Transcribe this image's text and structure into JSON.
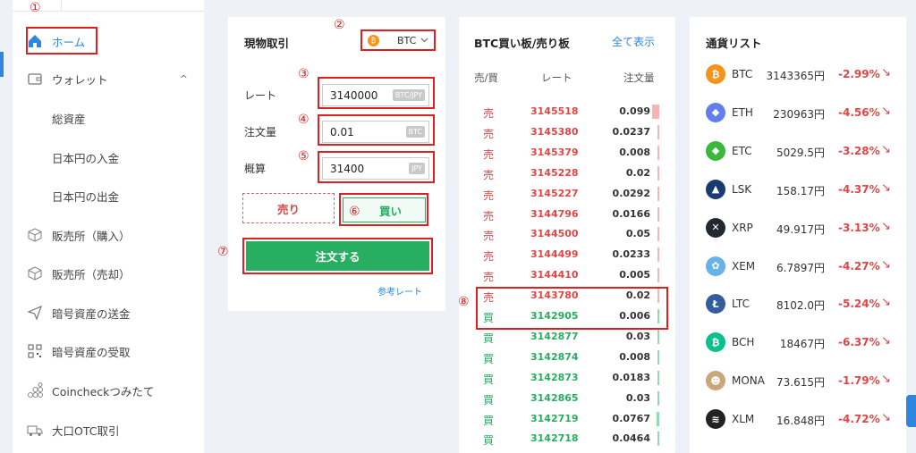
{
  "annotations": [
    "①",
    "②",
    "③",
    "④",
    "⑤",
    "⑥",
    "⑦",
    "⑧"
  ],
  "sidebar": {
    "items": [
      {
        "label": "ホーム",
        "icon": "home-icon"
      },
      {
        "label": "ウォレット",
        "icon": "wallet-icon",
        "caret": "^"
      },
      {
        "label": "総資産"
      },
      {
        "label": "日本円の入金"
      },
      {
        "label": "日本円の出金"
      },
      {
        "label": "販売所（購入）",
        "icon": "cube-icon"
      },
      {
        "label": "販売所（売却）",
        "icon": "cube-icon"
      },
      {
        "label": "暗号資産の送金",
        "icon": "send-icon"
      },
      {
        "label": "暗号資産の受取",
        "icon": "qr-icon"
      },
      {
        "label": "Coincheckつみたて",
        "icon": "coins-icon"
      },
      {
        "label": "大口OTC取引",
        "icon": "truck-icon"
      }
    ]
  },
  "trade": {
    "title": "現物取引",
    "coin": "BTC",
    "coin_glyph": "₿",
    "rate_label": "レート",
    "rate_value": "3140000",
    "rate_unit": "BTC/JPY",
    "amount_label": "注文量",
    "amount_value": "0.01",
    "amount_unit": "BTC",
    "estimate_label": "概算",
    "estimate_value": "31400",
    "estimate_unit": "JPY",
    "sell_label": "売り",
    "buy_label": "買い",
    "order_button": "注文する",
    "ref_link": "参考レート"
  },
  "orderbook": {
    "title": "BTC買い板/売り板",
    "show_all": "全て表示",
    "headers": [
      "売/買",
      "レート",
      "注文量"
    ],
    "rows": [
      {
        "side": "売",
        "rate": "3145518",
        "qty": "0.099",
        "fill": 0.9
      },
      {
        "side": "売",
        "rate": "3145380",
        "qty": "0.0237",
        "fill": 0.1
      },
      {
        "side": "売",
        "rate": "3145379",
        "qty": "0.008",
        "fill": 0.05
      },
      {
        "side": "売",
        "rate": "3145228",
        "qty": "0.02",
        "fill": 0.08
      },
      {
        "side": "売",
        "rate": "3145227",
        "qty": "0.0292",
        "fill": 0.12
      },
      {
        "side": "売",
        "rate": "3144796",
        "qty": "0.0166",
        "fill": 0.07
      },
      {
        "side": "売",
        "rate": "3144500",
        "qty": "0.05",
        "fill": 0.2
      },
      {
        "side": "売",
        "rate": "3144499",
        "qty": "0.0233",
        "fill": 0.1
      },
      {
        "side": "売",
        "rate": "3144410",
        "qty": "0.005",
        "fill": 0.03
      },
      {
        "side": "売",
        "rate": "3143780",
        "qty": "0.02",
        "fill": 0.08
      },
      {
        "side": "買",
        "rate": "3142905",
        "qty": "0.006",
        "fill": 0.04
      },
      {
        "side": "買",
        "rate": "3142877",
        "qty": "0.03",
        "fill": 0.12
      },
      {
        "side": "買",
        "rate": "3142874",
        "qty": "0.008",
        "fill": 0.05
      },
      {
        "side": "買",
        "rate": "3142873",
        "qty": "0.0183",
        "fill": 0.08
      },
      {
        "side": "買",
        "rate": "3142865",
        "qty": "0.03",
        "fill": 0.12
      },
      {
        "side": "買",
        "rate": "3142719",
        "qty": "0.0767",
        "fill": 0.35
      },
      {
        "side": "買",
        "rate": "3142718",
        "qty": "0.0464",
        "fill": 0.2
      }
    ]
  },
  "currency_list": {
    "title": "通貨リスト",
    "items": [
      {
        "sym": "BTC",
        "price": "3143365円",
        "change": "-2.99%",
        "color": "#f7931a",
        "glyph": "₿"
      },
      {
        "sym": "ETH",
        "price": "230963円",
        "change": "-4.56%",
        "color": "#627eea",
        "glyph": "◆"
      },
      {
        "sym": "ETC",
        "price": "5029.5円",
        "change": "-3.28%",
        "color": "#3ab83a",
        "glyph": "◆"
      },
      {
        "sym": "LSK",
        "price": "158.17円",
        "change": "-4.37%",
        "color": "#1a3b6e",
        "glyph": "▲"
      },
      {
        "sym": "XRP",
        "price": "49.917円",
        "change": "-3.13%",
        "color": "#23292f",
        "glyph": "✕"
      },
      {
        "sym": "XEM",
        "price": "6.7897円",
        "change": "-4.27%",
        "color": "#67b2e8",
        "glyph": "✿"
      },
      {
        "sym": "LTC",
        "price": "8102.0円",
        "change": "-5.24%",
        "color": "#345d9d",
        "glyph": "Ł"
      },
      {
        "sym": "BCH",
        "price": "18467円",
        "change": "-6.37%",
        "color": "#0ac18e",
        "glyph": "₿"
      },
      {
        "sym": "MONA",
        "price": "73.615円",
        "change": "-1.79%",
        "color": "#c9a77a",
        "glyph": "☻"
      },
      {
        "sym": "XLM",
        "price": "16.848円",
        "change": "-4.72%",
        "color": "#222222",
        "glyph": "≋"
      }
    ],
    "arrow": "↘"
  },
  "colors": {
    "accent": "#2e86de",
    "sell": "#e04646",
    "buy": "#27ae60",
    "highlight": "#e02020"
  }
}
